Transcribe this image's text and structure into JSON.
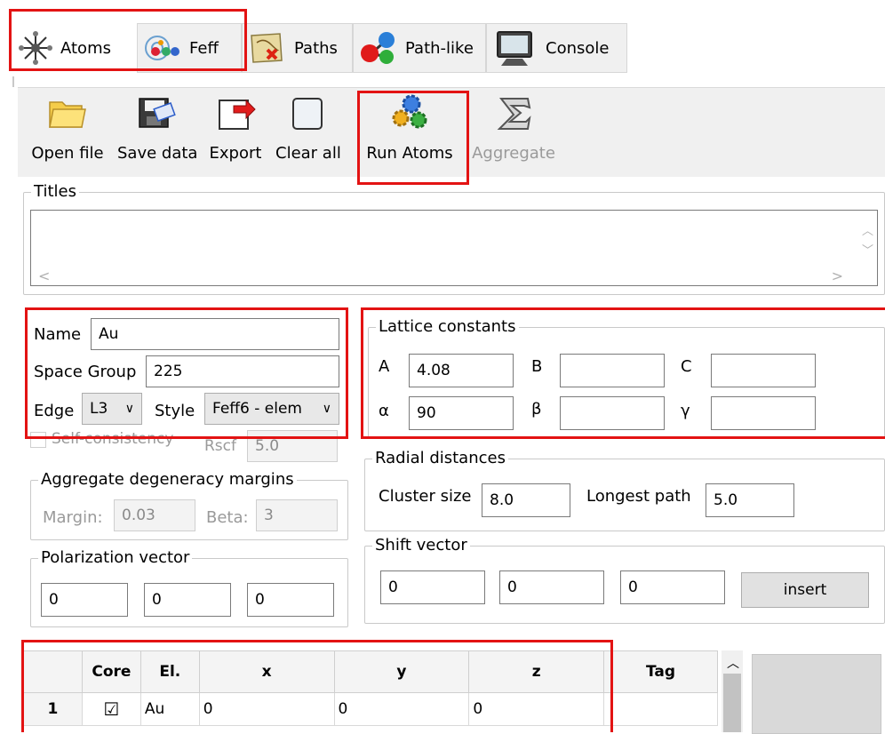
{
  "tabs": [
    {
      "label": "Atoms",
      "icon": "atoms-icon"
    },
    {
      "label": "Feff",
      "icon": "feff-icon"
    },
    {
      "label": "Paths",
      "icon": "paths-icon"
    },
    {
      "label": "Path-like",
      "icon": "path-like-icon"
    },
    {
      "label": "Console",
      "icon": "console-icon"
    }
  ],
  "toolbar": {
    "open_file": "Open file",
    "save_data": "Save data",
    "export": "Export",
    "clear_all": "Clear all",
    "run_atoms": "Run Atoms",
    "aggregate": "Aggregate"
  },
  "titles": {
    "label": "Titles",
    "value": ""
  },
  "crystal": {
    "name_label": "Name",
    "name": "Au",
    "space_group_label": "Space Group",
    "space_group": "225",
    "edge_label": "Edge",
    "edge": "L3",
    "style_label": "Style",
    "style": "Feff6 - elem",
    "self_consistency_label": "Self-consistency",
    "rscf_label": "Rscf",
    "rscf": "5.0"
  },
  "lattice": {
    "title": "Lattice constants",
    "a_label": "A",
    "a": "4.08",
    "b_label": "B",
    "b": "",
    "c_label": "C",
    "c": "",
    "alpha_label": "α",
    "alpha": "90",
    "beta_label": "β",
    "beta": "",
    "gamma_label": "γ",
    "gamma": ""
  },
  "aggregate_margins": {
    "title": "Aggregate degeneracy margins",
    "margin_label": "Margin:",
    "margin": "0.03",
    "beta_label": "Beta:",
    "beta": "3"
  },
  "radial": {
    "title": "Radial distances",
    "cluster_label": "Cluster size",
    "cluster": "8.0",
    "longest_label": "Longest path",
    "longest": "5.0"
  },
  "polarization": {
    "title": "Polarization vector",
    "x": "0",
    "y": "0",
    "z": "0"
  },
  "shift": {
    "title": "Shift vector",
    "x": "0",
    "y": "0",
    "z": "0",
    "insert": "insert"
  },
  "sites": {
    "headers": [
      "",
      "Core",
      "El.",
      "x",
      "y",
      "z",
      "Tag"
    ],
    "rows": [
      {
        "num": "1",
        "core": "☑",
        "el": "Au",
        "x": "0",
        "y": "0",
        "z": "0",
        "tag": ""
      }
    ]
  },
  "colors": {
    "highlight": "#e31313"
  }
}
